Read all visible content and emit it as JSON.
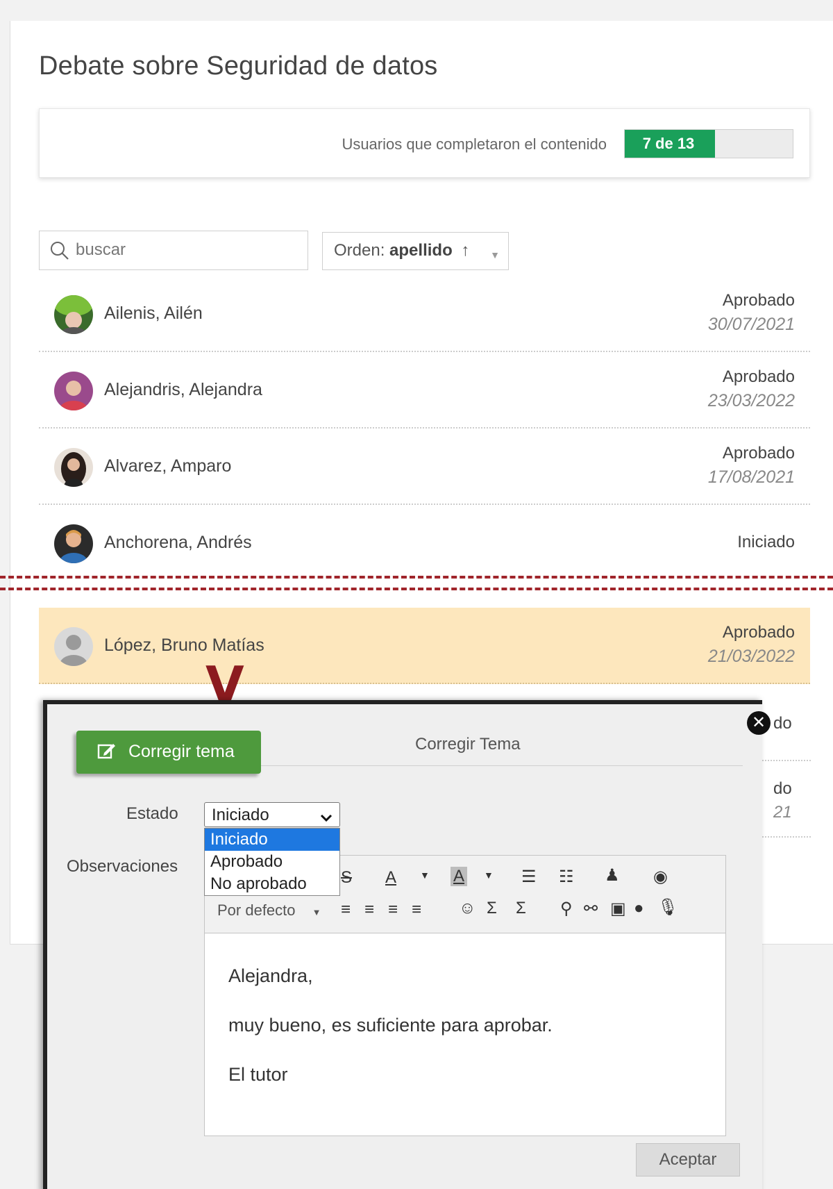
{
  "page": {
    "title": "Debate sobre Seguridad de datos"
  },
  "progress": {
    "label": "Usuarios que completaron el contenido",
    "text": "7 de 13",
    "completed": 7,
    "total": 13,
    "fill_color": "#1aa05a"
  },
  "search": {
    "placeholder": "buscar",
    "icon": "search-icon"
  },
  "order": {
    "prefix": "Orden:",
    "value": "apellido",
    "arrow": "↑"
  },
  "users": [
    {
      "name": "Ailenis, Ailén",
      "status": "Aprobado",
      "date": "30/07/2021"
    },
    {
      "name": "Alejandris, Alejandra",
      "status": "Aprobado",
      "date": "23/03/2022"
    },
    {
      "name": "Alvarez, Amparo",
      "status": "Aprobado",
      "date": "17/08/2021"
    },
    {
      "name": "Anchorena, Andrés",
      "status": "Iniciado",
      "date": ""
    },
    {
      "name": "López, Bruno Matías",
      "status": "Aprobado",
      "date": "21/03/2022",
      "highlighted": true
    }
  ],
  "peek": {
    "row6_status_tail": "do",
    "row7_status_tail": "do",
    "row7_date_tail": "21"
  },
  "annotation": {
    "mark": "V",
    "cut_color": "#a0252b"
  },
  "modal": {
    "heading": "Corregir Tema",
    "button_label": "Corregir tema",
    "close_glyph": "✕",
    "estado_label": "Estado",
    "observaciones_label": "Observaciones",
    "estado_selected": "Iniciado",
    "estado_options": [
      "Iniciado",
      "Aprobado",
      "No aprobado"
    ],
    "format_select": "Por defecto",
    "editor_lines": [
      "Alejandra,",
      "muy bueno, es suficiente para aprobar.",
      "El tutor"
    ],
    "accept_label": "Aceptar",
    "accent": "#4e9a3d"
  }
}
